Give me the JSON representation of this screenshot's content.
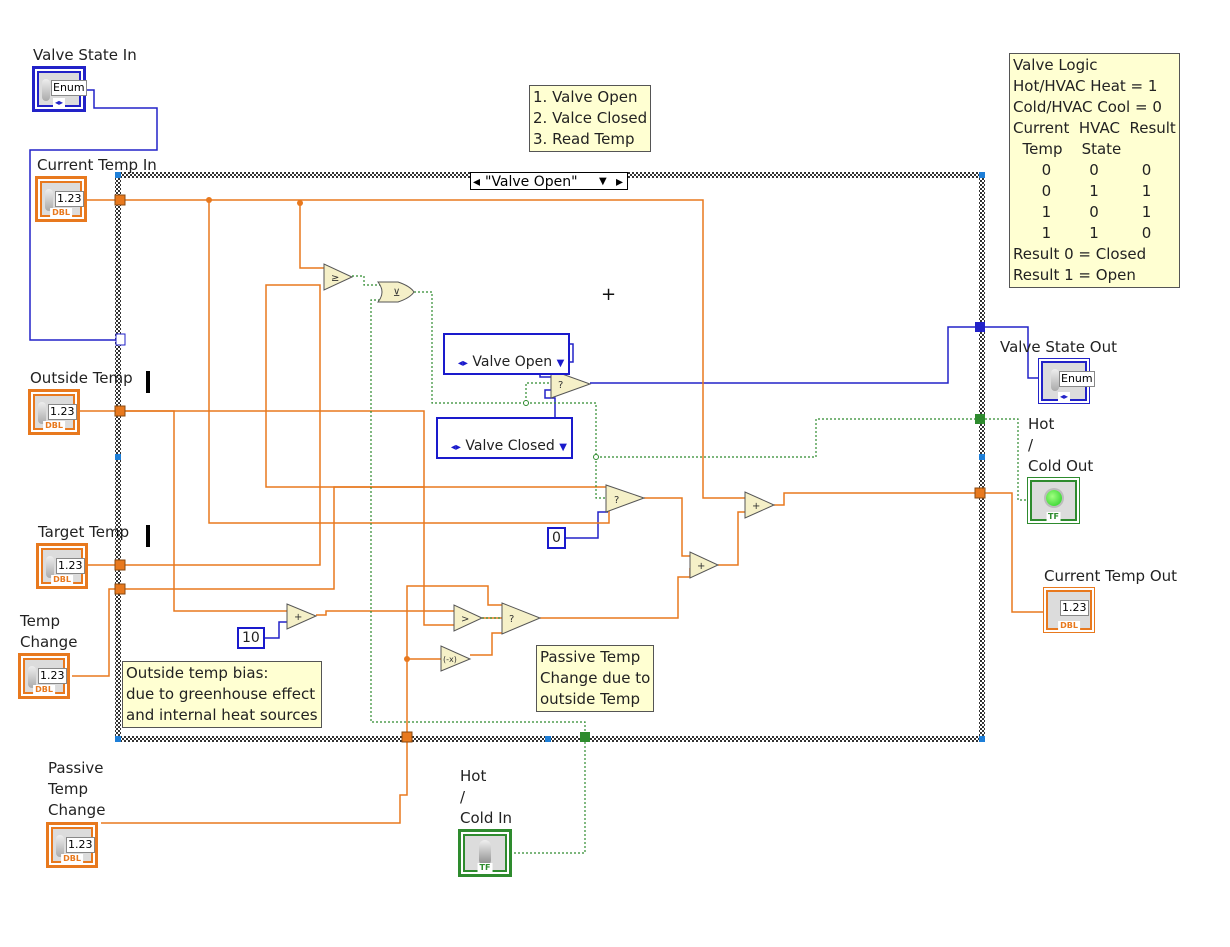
{
  "colors": {
    "numeric_wire": "#e8791e",
    "enum_wire": "#2222c8",
    "boolean_wire": "#2e8b2e",
    "node_fill": "#f5f0c8",
    "comment_fill": "#ffffd2"
  },
  "case_structure": {
    "selector_value": "\"Valve Open\"",
    "decrement_icon": "left-arrow",
    "increment_icon": "right-arrow",
    "dropdown_icon": "down-triangle"
  },
  "controls": {
    "valve_state_in": {
      "label": "Valve State In",
      "value": "Enum",
      "type_tag": "◂▸"
    },
    "current_temp_in": {
      "label": "Current Temp In",
      "value": "1.23",
      "type_tag": "DBL"
    },
    "outside_temp": {
      "label": "Outside Temp",
      "value": "1.23",
      "type_tag": "DBL"
    },
    "target_temp": {
      "label": "Target Temp",
      "value": "1.23",
      "type_tag": "DBL"
    },
    "temp_change": {
      "label": "Temp\nChange",
      "value": "1.23",
      "type_tag": "DBL"
    },
    "passive_temp_change": {
      "label": "Passive\nTemp\nChange",
      "value": "1.23",
      "type_tag": "DBL"
    },
    "hot_cold_in": {
      "label": "Hot\n/\nCold In",
      "type_tag": "TF"
    }
  },
  "indicators": {
    "valve_state_out": {
      "label": "Valve State Out",
      "value": "Enum",
      "type_tag": "◂▸"
    },
    "hot_cold_out": {
      "label": "Hot\n/\nCold Out",
      "type_tag": "TF",
      "led_state": "on"
    },
    "current_temp_out": {
      "label": "Current Temp Out",
      "value": "1.23",
      "type_tag": "DBL"
    }
  },
  "constants": {
    "valve_open": "Valve Open",
    "valve_closed": "Valve Closed",
    "ten": "10",
    "zero": "0"
  },
  "functions": {
    "greater_or_equal": "≥",
    "xor": "⊻",
    "select": "?",
    "add": "+",
    "greater": ">",
    "negate": "(-x)"
  },
  "comments": {
    "case_list": "1. Valve Open\n2. Valce Closed\n3. Read Temp",
    "valve_logic": "Valve Logic\nHot/HVAC Heat = 1\nCold/HVAC Cool = 0\nCurrent  HVAC  Result\n  Temp    State\n      0        0         0\n      0        1         1\n      1        0         1\n      1        1         0\nResult 0 = Closed\nResult 1 = Open",
    "outside_bias": "Outside temp bias:\ndue to greenhouse effect\nand internal heat sources",
    "passive_change": "Passive Temp\nChange due to\noutside Temp"
  }
}
